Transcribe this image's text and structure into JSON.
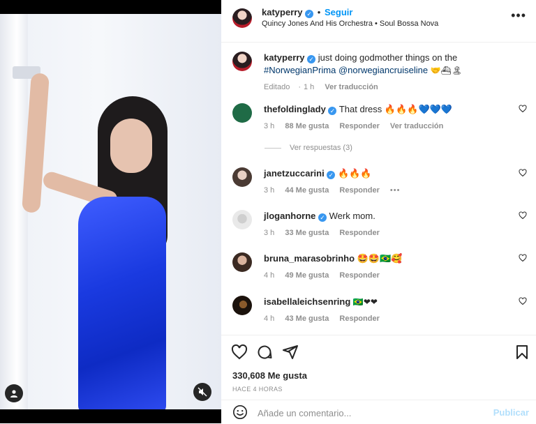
{
  "post": {
    "username": "katyperry",
    "follow_label": "Seguir",
    "audio": "Quincy Jones And His Orchestra • Soul Bossa Nova",
    "more_label": "•••"
  },
  "caption": {
    "username": "katyperry",
    "text": "just doing godmother things on the",
    "hashtag": "#NorwegianPrima",
    "mention": "@norwegiancruiseline",
    "emojis": "🤝⛴🏝",
    "edited": "Editado",
    "time": "1 h",
    "translate": "Ver traducción"
  },
  "comments": [
    {
      "username": "thefoldinglady",
      "verified": true,
      "text": "That dress 🔥🔥🔥💙💙💙",
      "time": "3 h",
      "likes": "88 Me gusta",
      "reply": "Responder",
      "translate": "Ver traducción"
    },
    {
      "username": "janetzuccarini",
      "verified": true,
      "text": "🔥🔥🔥",
      "time": "3 h",
      "likes": "44 Me gusta",
      "reply": "Responder",
      "options": "•••"
    },
    {
      "username": "jloganhorne",
      "verified": true,
      "text": "Werk mom.",
      "time": "3 h",
      "likes": "33 Me gusta",
      "reply": "Responder"
    },
    {
      "username": "bruna_marasobrinho",
      "verified": false,
      "text": "🤩🤩🇧🇷🥰",
      "time": "4 h",
      "likes": "49 Me gusta",
      "reply": "Responder"
    },
    {
      "username": "isabellaleichsenring",
      "verified": false,
      "text": "🇧🇷❤❤",
      "time": "4 h",
      "likes": "43 Me gusta",
      "reply": "Responder"
    }
  ],
  "view_replies": "Ver respuestas (3)",
  "likes_total": "330,608 Me gusta",
  "posted": "HACE 4 HORAS",
  "add_comment": {
    "placeholder": "Añade un comentario...",
    "publish": "Publicar"
  },
  "colors": {
    "accent": "#0095f6",
    "verified": "#3897f0",
    "publish_disabled": "#b2dffc",
    "dress": "#1a3ae0"
  },
  "icons": [
    "heart-icon",
    "comment-icon",
    "share-icon",
    "bookmark-icon",
    "emoji-icon",
    "user-tag-icon",
    "mute-icon",
    "verified-icon"
  ]
}
